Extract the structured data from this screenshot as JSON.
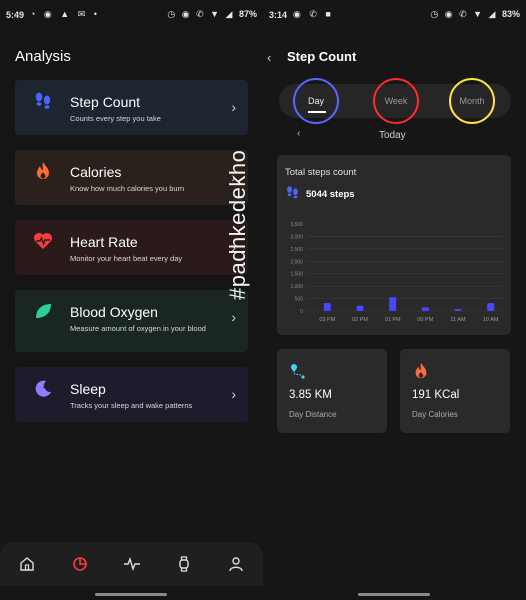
{
  "left": {
    "status": {
      "time": "5:49",
      "battery": "87%"
    },
    "title": "Analysis",
    "cards": [
      {
        "name": "Step Count",
        "desc": "Counts every step you take"
      },
      {
        "name": "Calories",
        "desc": "Know how much calories you burn"
      },
      {
        "name": "Heart Rate",
        "desc": "Monitor your heart beat every day"
      },
      {
        "name": "Blood Oxygen",
        "desc": "Measure amount of oxygen in your blood"
      },
      {
        "name": "Sleep",
        "desc": "Tracks your sleep and wake patterns"
      }
    ],
    "chevron": "›"
  },
  "watermark": "#padhkedekho",
  "right": {
    "status": {
      "time": "3:14",
      "battery": "83%"
    },
    "back": "‹",
    "title": "Step Count",
    "tabs": [
      "Day",
      "Week",
      "Month"
    ],
    "prev": "‹",
    "today": "Today",
    "steps_label": "Total steps count",
    "steps_value": "5044 steps",
    "distance_value": "3.85 KM",
    "distance_label": "Day Distance",
    "calories_value": "191 KCal",
    "calories_label": "Day Calories"
  },
  "chart_data": {
    "type": "bar",
    "categories": [
      "03 PM",
      "02 PM",
      "01 PM",
      "00 PM",
      "11 AM",
      "10 AM"
    ],
    "values": [
      320,
      210,
      560,
      150,
      80,
      320
    ],
    "yticks": [
      "3,500",
      "3,000",
      "2,500",
      "2,000",
      "1,500",
      "1,000",
      "500",
      "0"
    ],
    "ylim": [
      0,
      3500
    ],
    "bar_color": "#4648ff"
  },
  "colors": {
    "step": "#4b63ff",
    "calories": "#ff6a3d",
    "heart": "#ff3b3b",
    "oxygen": "#2ecf9a",
    "sleep": "#8e7dff"
  }
}
